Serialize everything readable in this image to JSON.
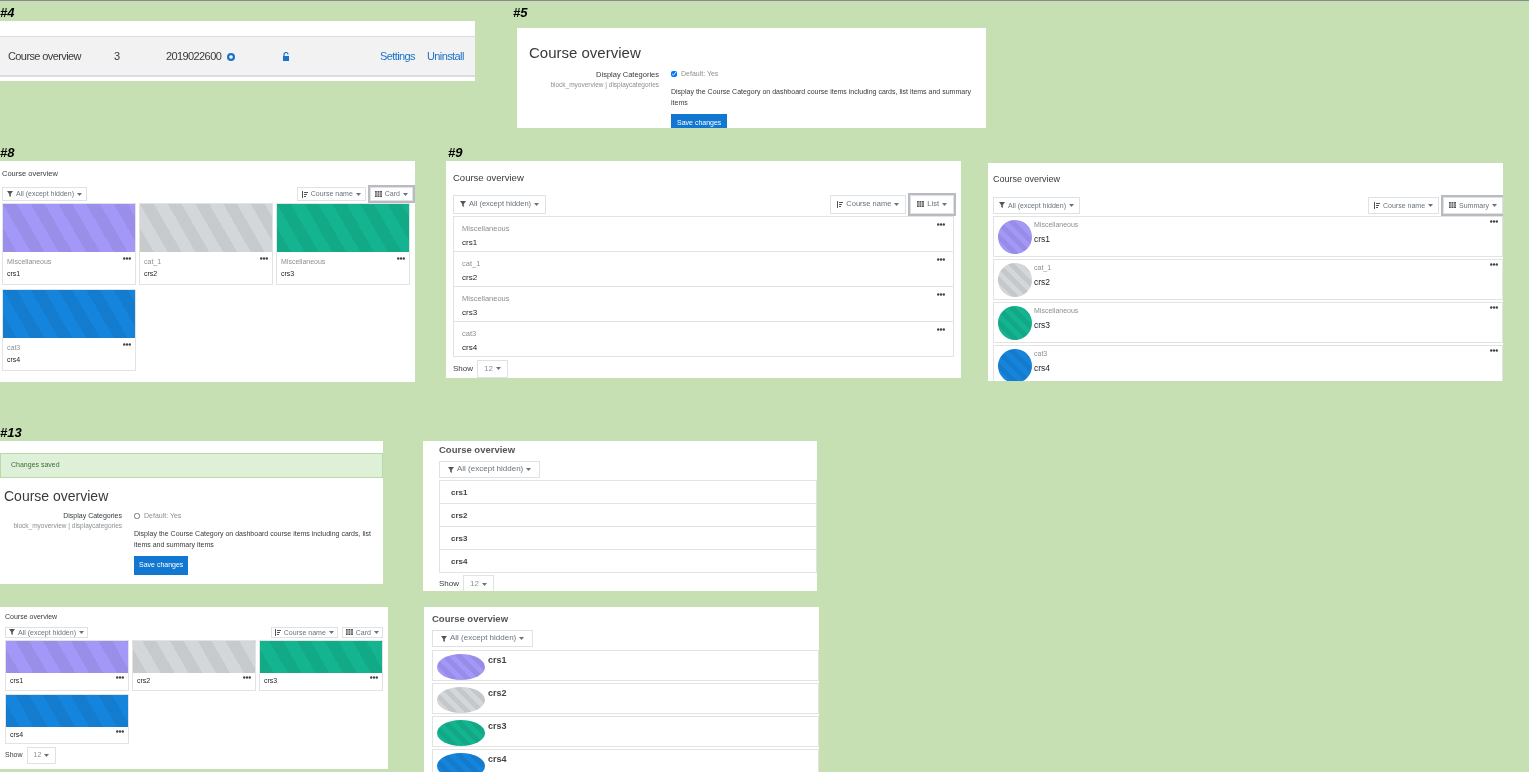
{
  "panels": [
    {
      "label": "#4",
      "kind": "plugin_row",
      "name": "Course overview",
      "version": "3",
      "release": "2019022600",
      "settings_link": "Settings",
      "uninstall_link": "Uninstall"
    },
    {
      "label": "#5",
      "kind": "settings",
      "heading": "Course overview",
      "setting_label": "Display Categories",
      "setting_path": "block_myoverview | displaycategories",
      "default": {
        "label": "Default: Yes",
        "checked": true
      },
      "description": "Display the Course Category on dashboard course items including cards, list items and summary items",
      "button": "Save changes"
    },
    {
      "label": "#8",
      "kind": "card_overview",
      "title": "Course overview",
      "filter": "All (except hidden)",
      "sort": "Course name",
      "view": {
        "label": "Card",
        "focused": true
      },
      "show_menu": true,
      "courses": [
        {
          "category": "Miscellaneous",
          "name": "crs1",
          "color": "#a397f7"
        },
        {
          "category": "cat_1",
          "name": "crs2",
          "color": "#d3d7da"
        },
        {
          "category": "Miscellaneous",
          "name": "crs3",
          "color": "#13b48f"
        },
        {
          "category": "cat3",
          "name": "crs4",
          "color": "#1584dc"
        }
      ]
    },
    {
      "label": "#9",
      "kind": "list_overview",
      "title": "Course overview",
      "filter": "All (except hidden)",
      "sort": "Course name",
      "view": {
        "label": "List",
        "focused": true
      },
      "show_menu": true,
      "courses": [
        {
          "category": "Miscellaneous",
          "name": "crs1"
        },
        {
          "category": "cat_1",
          "name": "crs2"
        },
        {
          "category": "Miscellaneous",
          "name": "crs3"
        },
        {
          "category": "cat3",
          "name": "crs4"
        }
      ],
      "show": {
        "label": "Show",
        "value": "12"
      }
    },
    {
      "kind": "summary_overview",
      "title": "Course overview",
      "filter": "All (except hidden)",
      "sort": "Course name",
      "view": {
        "label": "Summary",
        "focused": true
      },
      "show_menu": true,
      "courses": [
        {
          "category": "Miscellaneous",
          "name": "crs1",
          "color": "#a397f7"
        },
        {
          "category": "cat_1",
          "name": "crs2",
          "color": "#d3d7da"
        },
        {
          "category": "Miscellaneous",
          "name": "crs3",
          "color": "#13b48f"
        },
        {
          "category": "cat3",
          "name": "crs4",
          "color": "#1584dc"
        }
      ]
    },
    {
      "label": "#13",
      "kind": "settings",
      "notice": "Changes saved",
      "heading": "Course overview",
      "setting_label": "Display Categories",
      "setting_path": "block_myoverview | displaycategories",
      "default": {
        "label": "Default: Yes",
        "checked": false
      },
      "description": "Display the Course Category on dashboard course items including cards, list items and summary items",
      "button": "Save changes"
    },
    {
      "kind": "list_overview",
      "title": "Course overview",
      "filter": "All (except hidden)",
      "show_menu": false,
      "courses": [
        {
          "name": "crs1"
        },
        {
          "name": "crs2"
        },
        {
          "name": "crs3"
        },
        {
          "name": "crs4"
        }
      ],
      "show": {
        "label": "Show",
        "value": "12"
      }
    },
    {
      "kind": "card_overview",
      "title": "Course overview",
      "filter": "All (except hidden)",
      "sort": "Course name",
      "view": {
        "label": "Card",
        "focused": false
      },
      "show_menu": true,
      "courses": [
        {
          "name": "crs1",
          "color": "#a397f7"
        },
        {
          "name": "crs2",
          "color": "#d3d7da"
        },
        {
          "name": "crs3",
          "color": "#13b48f"
        },
        {
          "name": "crs4",
          "color": "#1584dc"
        }
      ],
      "show": {
        "label": "Show",
        "value": "12"
      }
    },
    {
      "kind": "summary_overview",
      "title": "Course overview",
      "filter": "All (except hidden)",
      "show_menu": false,
      "courses": [
        {
          "name": "crs1",
          "color": "#a397f7"
        },
        {
          "name": "crs2",
          "color": "#d3d7da"
        },
        {
          "name": "crs3",
          "color": "#13b48f"
        },
        {
          "name": "crs4",
          "color": "#1584dc"
        }
      ]
    }
  ]
}
